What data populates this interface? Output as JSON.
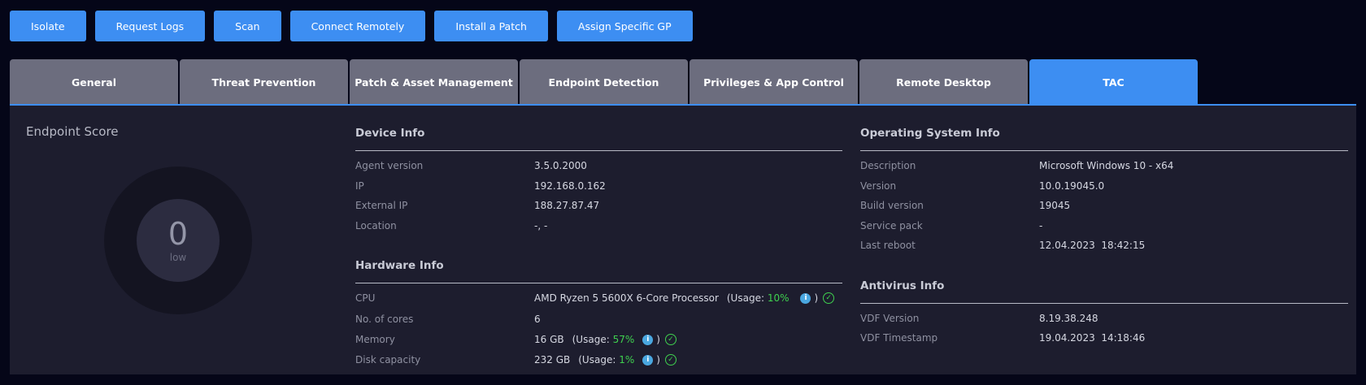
{
  "actions": [
    "Isolate",
    "Request Logs",
    "Scan",
    "Connect Remotely",
    "Install a Patch",
    "Assign Specific GP"
  ],
  "tabs": [
    "General",
    "Threat Prevention",
    "Patch & Asset Management",
    "Endpoint Detection",
    "Privileges & App Control",
    "Remote Desktop",
    "TAC"
  ],
  "active_tab": "TAC",
  "endpoint_score": {
    "title": "Endpoint Score",
    "value": "0",
    "level": "low"
  },
  "device_info": {
    "title": "Device Info",
    "rows": [
      {
        "label": "Agent version",
        "value": "3.5.0.2000"
      },
      {
        "label": "IP",
        "value": "192.168.0.162"
      },
      {
        "label": "External IP",
        "value": "188.27.87.47"
      },
      {
        "label": "Location",
        "value": "-, -"
      }
    ]
  },
  "hardware_info": {
    "title": "Hardware Info",
    "cpu": {
      "label": "CPU",
      "value": "AMD Ryzen 5 5600X 6-Core Processor",
      "usage_prefix": "(Usage: ",
      "usage": "10%",
      "usage_suffix": ")"
    },
    "cores": {
      "label": "No. of cores",
      "value": "6"
    },
    "memory": {
      "label": "Memory",
      "value": "16 GB",
      "usage_prefix": "(Usage: ",
      "usage": "57%",
      "usage_suffix": ")"
    },
    "disk": {
      "label": "Disk capacity",
      "value": "232 GB",
      "usage_prefix": "(Usage: ",
      "usage": "1%",
      "usage_suffix": ")"
    }
  },
  "os_info": {
    "title": "Operating System Info",
    "rows": [
      {
        "label": "Description",
        "value": "Microsoft Windows 10 - x64"
      },
      {
        "label": "Version",
        "value": "10.0.19045.0"
      },
      {
        "label": "Build version",
        "value": "19045"
      },
      {
        "label": "Service pack",
        "value": "-"
      },
      {
        "label": "Last reboot",
        "value": "12.04.2023  18:42:15"
      }
    ]
  },
  "antivirus_info": {
    "title": "Antivirus Info",
    "rows": [
      {
        "label": "VDF Version",
        "value": "8.19.38.248"
      },
      {
        "label": "VDF Timestamp",
        "value": "19.04.2023  14:18:46"
      }
    ]
  },
  "icons": {
    "info": "info-icon",
    "check": "check-circle-icon"
  },
  "colors": {
    "accent": "#3d8ef2",
    "usage_green": "#3fd14f",
    "tab_inactive": "#6c6d7e"
  }
}
